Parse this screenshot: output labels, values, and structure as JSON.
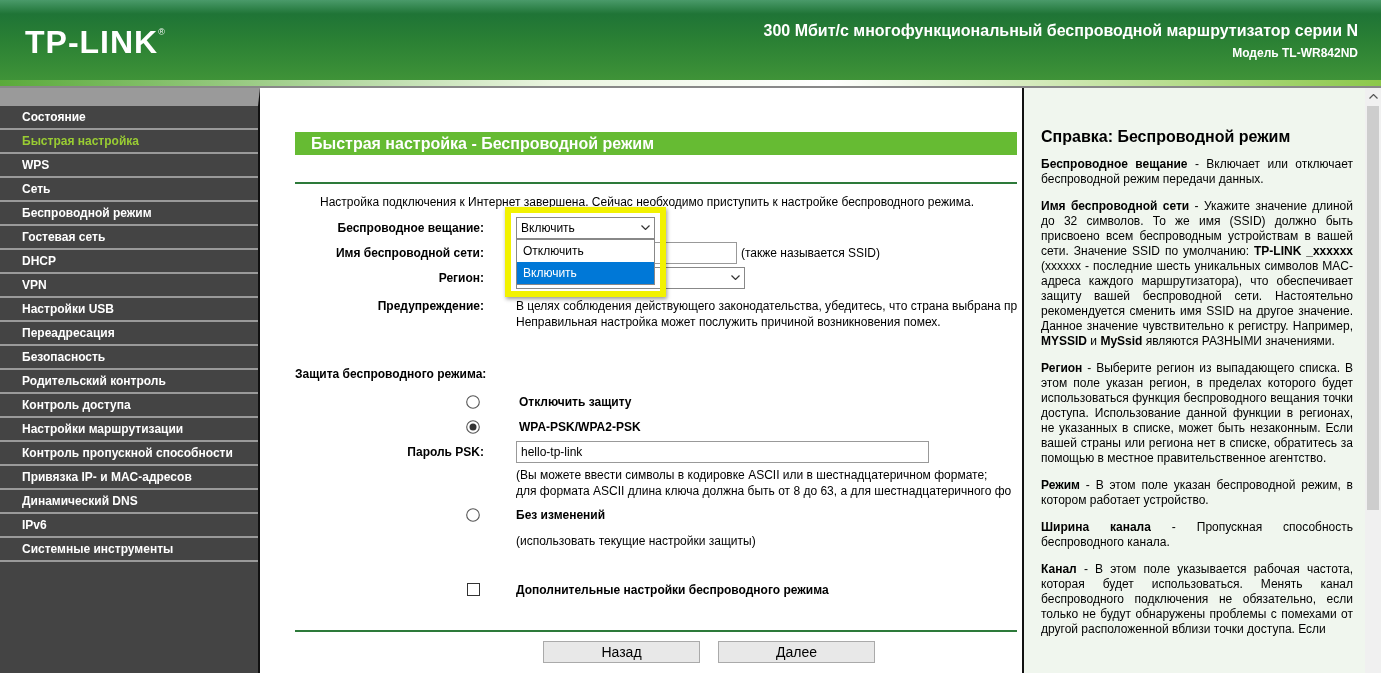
{
  "header": {
    "logo": "TP-LINK$^{®}$",
    "title": "300 Мбит/с многофункциональный беспроводной маршрутизатор серии N",
    "model": "Модель TL-WR842ND"
  },
  "sidebar": {
    "items": [
      {
        "label": "Состояние",
        "selected": false
      },
      {
        "label": "Быстрая настройка",
        "selected": true
      },
      {
        "label": "WPS",
        "selected": false
      },
      {
        "label": "Сеть",
        "selected": false
      },
      {
        "label": "Беспроводной режим",
        "selected": false
      },
      {
        "label": "Гостевая сеть",
        "selected": false
      },
      {
        "label": "DHCP",
        "selected": false
      },
      {
        "label": "VPN",
        "selected": false
      },
      {
        "label": "Настройки USB",
        "selected": false
      },
      {
        "label": "Переадресация",
        "selected": false
      },
      {
        "label": "Безопасность",
        "selected": false
      },
      {
        "label": "Родительский контроль",
        "selected": false
      },
      {
        "label": "Контроль доступа",
        "selected": false
      },
      {
        "label": "Настройки маршрутизации",
        "selected": false
      },
      {
        "label": "Контроль пропускной способности",
        "selected": false
      },
      {
        "label": "Привязка IP- и MAC-адресов",
        "selected": false
      },
      {
        "label": "Динамический DNS",
        "selected": false
      },
      {
        "label": "IPv6",
        "selected": false
      },
      {
        "label": "Системные инструменты",
        "selected": false
      }
    ]
  },
  "main": {
    "title": "Быстрая настройка - Беспроводной режим",
    "intro": "Настройка подключения к Интернет завершена. Сейчас необходимо приступить к настройке беспроводного режима.",
    "broadcast": {
      "label": "Беспроводное вещание:",
      "value": "Включить",
      "expanded": true,
      "highlighted": true,
      "options": [
        {
          "label": "Отключить",
          "selected": false
        },
        {
          "label": "Включить",
          "selected": true
        }
      ]
    },
    "ssid": {
      "label": "Имя беспроводной сети:",
      "hint": "(также называется SSID)"
    },
    "region": {
      "label": "Регион:"
    },
    "warning": {
      "label": "Предупреждение:",
      "lines": [
        "В целях соблюдения действующего законодательства, убедитесь, что страна выбрана пр",
        "Неправильная настройка может послужить причиной возникновения помех."
      ]
    },
    "security": {
      "heading": "Защита беспроводного режима:",
      "options": [
        {
          "label": "Отключить защиту",
          "selected": false
        },
        {
          "label": "WPA-PSK/WPA2-PSK",
          "selected": true,
          "password_label": "Пароль PSK:",
          "password": "hello-tp-link",
          "notes": [
            "(Вы можете ввести символы в кодировке ASCII или в шестнадцатеричном формате;",
            "для формата ASCII длина ключа должна быть от 8 до 63, а для шестнадцатеричного фо"
          ]
        },
        {
          "label": "Без изменений",
          "selected": false,
          "notes": [
            "(использовать текущие настройки защиты)"
          ]
        }
      ]
    },
    "advanced": {
      "label": "Дополнительные настройки беспроводного режима",
      "checked": false
    },
    "buttons": [
      "Назад",
      "Далее"
    ]
  },
  "help": {
    "title": "Справка: Беспроводной режим",
    "paragraphs": [
      "**Беспроводное вещание** - Включает или отключает беспроводной режим передачи данных.",
      "**Имя беспроводной сети** - Укажите значение длиной до 32 символов. То же имя (SSID) должно быть присвоено всем беспроводным устройствам в вашей сети. Значение SSID по умолчанию: **TP-LINK _xxxxxx** (xxxxxx - последние шесть уникальных символов MAC-адреса каждого маршрутизатора), что обеспечивает защиту вашей беспроводной сети. Настоятельно рекомендуется сменить имя SSID на другое значение. Данное значение чувствительно к регистру. Например, **MYSSID** и **MySsid** являются РАЗНЫМИ значениями.",
      "**Регион** - Выберите регион из выпадающего списка. В этом поле указан регион, в пределах которого будет использоваться функция беспроводного вещания точки доступа. Использование данной функции в регионах, не указанных в списке, может быть незаконным. Если вашей страны или региона нет в списке, обратитесь за помощью в местное правительственное агентство.",
      "**Режим** - В этом поле указан беспроводной режим, в котором работает устройство.",
      "**Ширина канала** - Пропускная способность беспроводного канала.",
      "**Канал** - В этом поле указывается рабочая частота, которая будет использоваться. Менять канал беспроводного подключения не обязательно, если только не будут обнаружены проблемы с помехами от другой расположенной вблизи точки доступа. Если"
    ]
  }
}
